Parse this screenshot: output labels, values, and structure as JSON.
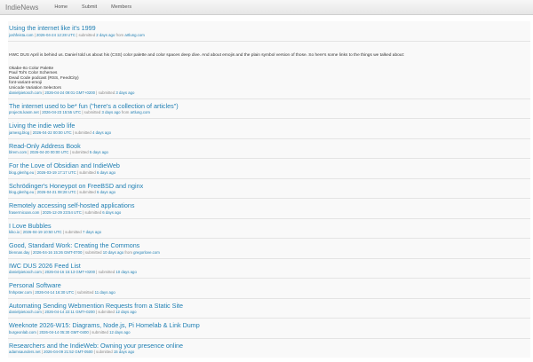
{
  "nav": {
    "brand": "IndieNews",
    "links": [
      "Home",
      "Submit",
      "Members"
    ]
  },
  "posts": [
    {
      "title": "Using the internet like it's 1999",
      "domain": "joshfeista.com",
      "date": "2026-04-24 12:28 UTC",
      "submitted_prefix": "submitted",
      "submitted": "2 days ago",
      "from_word": "from",
      "from": "artlung.com"
    },
    {
      "title": "",
      "body": "HWC DUS April is behind us. Daniel told us about his (CSS) color palette and color spaces deep dive. And about emojis and the plain symbol version of those. So here's some links to the things we talked about:",
      "list": [
        "Okabe-Ito Color Palette",
        "Paul Tol's Color Schemes",
        "Dead Code podcast (RSS, FeedCity)",
        "font-variant-emoji",
        "Unicode Variation Selectors"
      ],
      "domain": "danielpietosch.com",
      "date": "2026-04-24 09:01 GMT+0200",
      "submitted_prefix": "submitted",
      "submitted": "3 days ago"
    },
    {
      "title": "The internet used to be* fun (\"here's a collection of articles\")",
      "domain": "projects.kasm.net",
      "date": "2026-04-23 15:55 UTC",
      "submitted_prefix": "submitted",
      "submitted": "3 days ago",
      "from_word": "from",
      "from": "artlung.com"
    },
    {
      "title": "Living the indie web life",
      "domain": "jamesg.blog",
      "date": "2026-04-22 00:00 UTC",
      "submitted_prefix": "submitted",
      "submitted": "4 days ago"
    },
    {
      "title": "Read-Only Address Book",
      "domain": "blrem.com",
      "date": "2026-04-20 00:00 UTC",
      "submitted_prefix": "submitted",
      "submitted": "5 days ago"
    },
    {
      "title": "For the Love of Obsidian and IndieWeb",
      "domain": "blog.glenhg.eu",
      "date": "2026-03-19 17:17 UTC",
      "submitted_prefix": "submitted",
      "submitted": "6 days ago"
    },
    {
      "title": "Schrödinger's Honeypot on FreeBSD and nginx",
      "domain": "blog.glenhg.eu",
      "date": "2026-04-21 08:28 UTC",
      "submitted_prefix": "submitted",
      "submitted": "6 days ago"
    },
    {
      "title": "Remotely accessing self-hosted applications",
      "domain": "fraserrnicoan.com",
      "date": "2025-12-29 23:54 UTC",
      "submitted_prefix": "submitted",
      "submitted": "6 days ago"
    },
    {
      "title": "I Love Bubbles",
      "domain": "kiko.io",
      "date": "2026-04-19 10:50 UTC",
      "submitted_prefix": "submitted",
      "submitted": "7 days ago"
    },
    {
      "title": "Good, Standard Work: Creating the Commons",
      "domain": "blennan.day",
      "date": "2026-04-16 15:26 GMT-0700",
      "submitted_prefix": "submitted",
      "submitted": "10 days ago",
      "from_word": "from",
      "from": "gregorlove.com"
    },
    {
      "title": "IWC DUS 2026 Feed List",
      "domain": "danielpietosch.com",
      "date": "2026-04-16 15:13 GMT+0200",
      "submitted_prefix": "submitted",
      "submitted": "10 days ago"
    },
    {
      "title": "Personal Software",
      "domain": "fmhpster.com",
      "date": "2026-04-14 16:30 UTC",
      "submitted_prefix": "submitted",
      "submitted": "11 days ago"
    },
    {
      "title": "Automating Sending Webmention Requests from a Static Site",
      "domain": "danielpietosch.com",
      "date": "2026-04-14 22:11 GMT+0200",
      "submitted_prefix": "submitted",
      "submitted": "12 days ago"
    },
    {
      "title": "Weeknote 2026-W15: Diagrams, Node.js, Pi Homelab & Link Dump",
      "domain": "burgeonlab.com",
      "date": "2026-04-14 05:30 GMT-0400",
      "submitted_prefix": "submitted",
      "submitted": "12 days ago"
    },
    {
      "title": "Researchers and the IndieWeb: Owning your presence online",
      "domain": "adamsaunders.net",
      "date": "2026-04-09 21:52 GMT-0500",
      "submitted_prefix": "submitted",
      "submitted": "15 days ago"
    }
  ]
}
